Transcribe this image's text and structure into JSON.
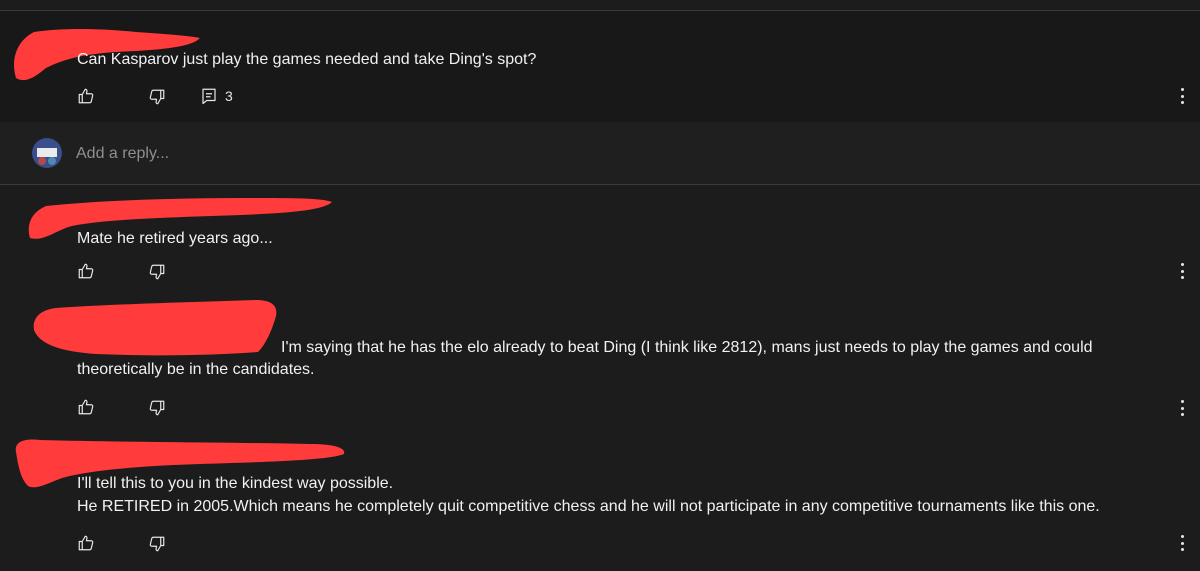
{
  "thread": {
    "comment": {
      "text": "Can Kasparov just play the games needed and take Ding's spot?",
      "reply_count": "3",
      "icons": {
        "like": "thumbs-up-icon",
        "dislike": "thumbs-down-icon",
        "replies": "comment-icon",
        "more": "more-vert-icon"
      }
    },
    "reply_input": {
      "placeholder": "Add a reply..."
    },
    "replies": [
      {
        "text": "Mate he retired years ago..."
      },
      {
        "line1": "I'm saying that he has the elo already to beat Ding (I think like 2812), mans just needs to play the games and could",
        "line2": "theoretically be in the candidates."
      },
      {
        "line1": "I'll tell this to you in the kindest way possible.",
        "line2": "He RETIRED in 2005.Which means he completely quit competitive chess and he will not participate in any competitive tournaments like this one."
      }
    ]
  },
  "colors": {
    "background": "#1c1c1c",
    "main_comment_bg": "#181818",
    "text": "#f1f1f1",
    "muted": "#8f8f8f",
    "redaction": "#ff3b3b"
  }
}
